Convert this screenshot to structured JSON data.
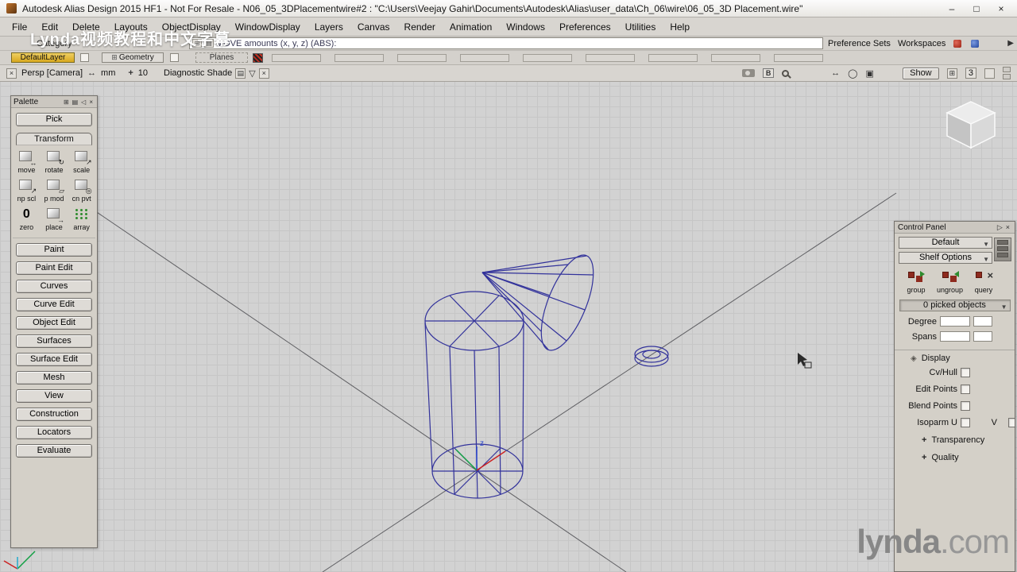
{
  "titlebar": {
    "app_title": "Autodesk Alias Design 2015 HF1  - Not For Resale    - N06_05_3DPlacementwire#2 : \"C:\\Users\\Veejay Gahir\\Documents\\Autodesk\\Alias\\user_data\\Ch_06\\wire\\06_05_3D Placement.wire\""
  },
  "menubar": {
    "items": [
      "File",
      "Edit",
      "Delete",
      "Layouts",
      "ObjectDisplay",
      "WindowDisplay",
      "Layers",
      "Canvas",
      "Render",
      "Animation",
      "Windows",
      "Preferences",
      "Utilities",
      "Help"
    ]
  },
  "promptline": {
    "category": "Category",
    "prompt": "MOVE amounts (x, y, z) (ABS):",
    "preference_sets": "Preference Sets",
    "workspaces": "Workspaces"
  },
  "layerbar": {
    "default_layer": "DefaultLayer",
    "geometry": "Geometry",
    "planes": "Planes"
  },
  "viewportbar": {
    "camera": "Persp [Camera]",
    "units": "mm",
    "grid_size": "10",
    "shade_mode": "Diagnostic Shade",
    "show": "Show",
    "window_number": "3"
  },
  "palette": {
    "title": "Palette",
    "pick": "Pick",
    "transform": "Transform",
    "tools": {
      "move": "move",
      "rotate": "rotate",
      "scale": "scale",
      "np_scl": "np scl",
      "p_mod": "p mod",
      "cn_pvt": "cn pvt",
      "zero": "zero",
      "place": "place",
      "array": "array"
    },
    "buttons": [
      "Paint",
      "Paint Edit",
      "Curves",
      "Curve Edit",
      "Object Edit",
      "Surfaces",
      "Surface Edit",
      "Mesh",
      "View",
      "Construction",
      "Locators",
      "Evaluate"
    ]
  },
  "control_panel": {
    "title": "Control Panel",
    "preset": "Default",
    "shelf_options": "Shelf Options",
    "group": "group",
    "ungroup": "ungroup",
    "query": "query",
    "picked": "0 picked objects",
    "degree": "Degree",
    "spans": "Spans",
    "display": "Display",
    "cv_hull": "Cv/Hull",
    "edit_points": "Edit Points",
    "blend_points": "Blend Points",
    "isoparm_u": "Isoparm U",
    "isoparm_v": "V",
    "transparency": "Transparency",
    "quality": "Quality"
  },
  "scene": {
    "z_axis_label": "z",
    "objects": [
      "cylinder",
      "cone",
      "torus"
    ]
  },
  "watermarks": {
    "overlay_cn": "Lynda视频教程和中文字幕",
    "brand": "lynda",
    "brand_tld": ".com"
  },
  "icons": {
    "minimize": "–",
    "maximize": "□",
    "close": "×",
    "dropdown": "▼",
    "dropdown_open": "▽",
    "tri_right": "▷",
    "tri_left": "◁",
    "menu_arrow": "▶",
    "list": "▤",
    "grid_box": "⊞",
    "arrows_h": "↔",
    "rotate_arrow": "↻",
    "scale_arrow": "↗",
    "pmod_glyph": "▱",
    "pivot_glyph": "◎",
    "place_arrow": "→",
    "zero_glyph": "0",
    "plus": "+",
    "diamond": "◈",
    "orbit": "◯",
    "frame": "▣",
    "x_mark": "×",
    "up_box": "⊞"
  },
  "colors": {
    "wireframe": "#32329b",
    "layer_gold": "#e0b42f",
    "viewport_bg": "#d2d2d2",
    "grid_line": "#c6c6c6",
    "axis_x_red": "#cc2222",
    "axis_y_green": "#11a044",
    "axis_z_blue": "#2643cc"
  }
}
